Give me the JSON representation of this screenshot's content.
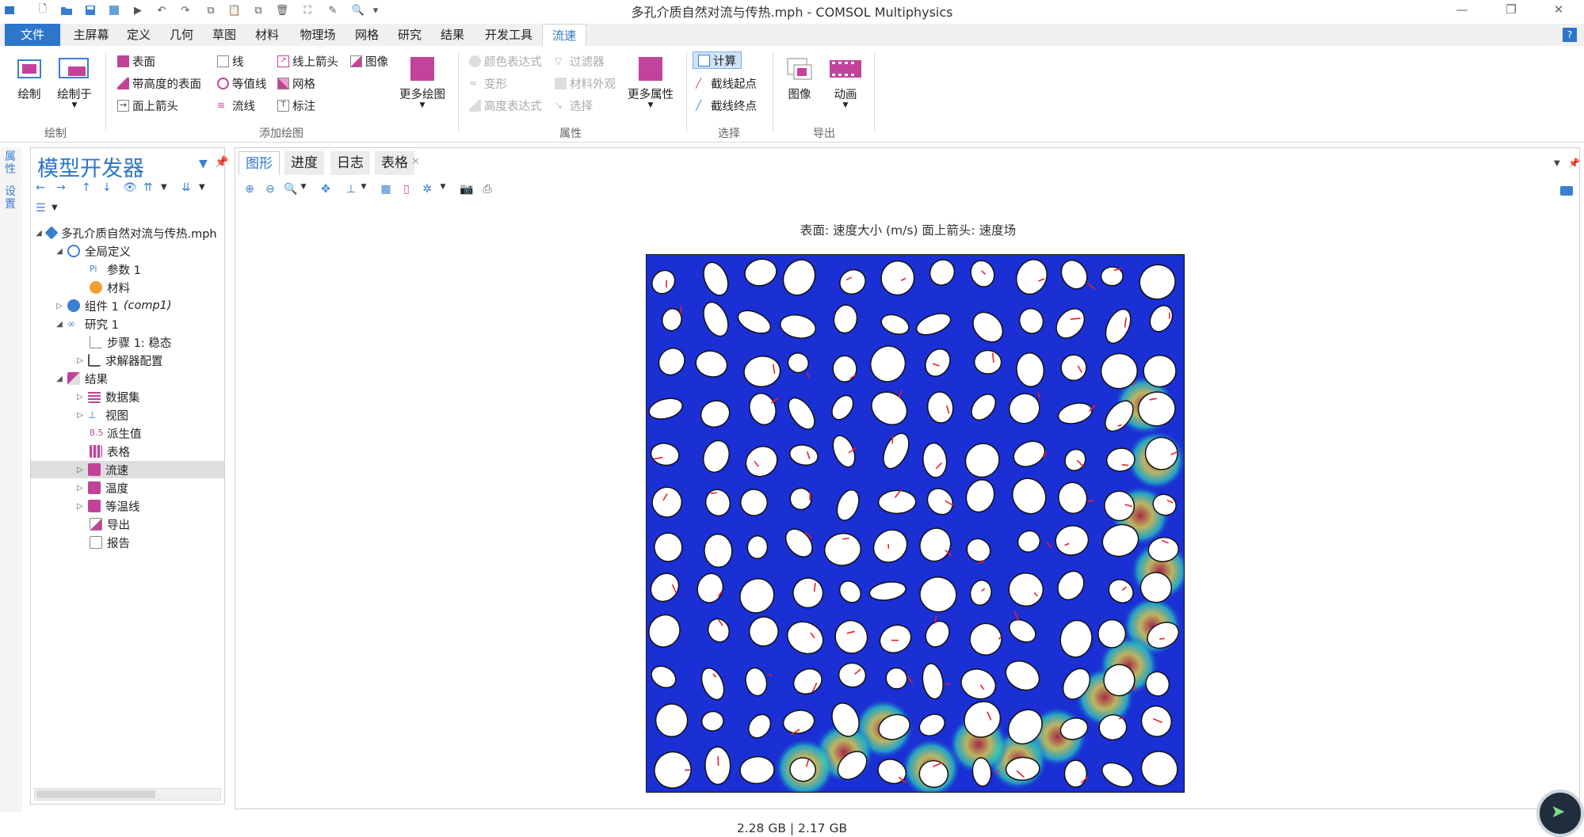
{
  "window": {
    "title": "多孔介质自然对流与传热.mph - COMSOL Multiphysics",
    "minimize": "—",
    "restore": "❐",
    "close": "✕"
  },
  "menu": {
    "file": "文件",
    "tabs": [
      "主屏幕",
      "定义",
      "几何",
      "草图",
      "材料",
      "物理场",
      "网格",
      "研究",
      "结果",
      "开发工具",
      "流速"
    ],
    "help": "?"
  },
  "ribbon": {
    "plot": {
      "draw": "绘制",
      "draw_to": "绘制于",
      "group": "绘制"
    },
    "add_plot": {
      "surface": "表面",
      "height_surface": "带高度的表面",
      "arrow_surface": "面上箭头",
      "line": "线",
      "contour": "等值线",
      "streamline": "流线",
      "arrow_line": "线上箭头",
      "mesh": "网格",
      "annotation": "标注",
      "image": "图像",
      "more_plots": "更多绘图",
      "group": "添加绘图"
    },
    "attributes": {
      "color_expr": "颜色表达式",
      "deformation": "变形",
      "height_expr": "高度表达式",
      "filter": "过滤器",
      "material_appearance": "材料外观",
      "selection": "选择",
      "more_attrs": "更多属性",
      "group": "属性"
    },
    "select": {
      "compute": "计算",
      "cut_start": "截线起点",
      "cut_end": "截线终点",
      "group": "选择"
    },
    "export": {
      "image": "图像",
      "animation": "动画",
      "group": "导出"
    }
  },
  "left_strip": {
    "prop": "属性",
    "settings": "设置"
  },
  "model_builder": {
    "title": "模型开发器",
    "tree": [
      {
        "label": "多孔介质自然对流与传热.mph",
        "level": 0
      },
      {
        "label": "全局定义",
        "level": 1
      },
      {
        "label": "参数 1",
        "level": 2
      },
      {
        "label": "材料",
        "level": 2
      },
      {
        "label": "组件 1",
        "sub": "(comp1)",
        "level": 1
      },
      {
        "label": "研究 1",
        "level": 1
      },
      {
        "label": "步骤 1: 稳态",
        "level": 2
      },
      {
        "label": "求解器配置",
        "level": 2
      },
      {
        "label": "结果",
        "level": 1
      },
      {
        "label": "数据集",
        "level": 2
      },
      {
        "label": "视图",
        "level": 2
      },
      {
        "label": "派生值",
        "level": 2
      },
      {
        "label": "表格",
        "level": 2
      },
      {
        "label": "流速",
        "level": 2
      },
      {
        "label": "温度",
        "level": 2
      },
      {
        "label": "等温线",
        "level": 2
      },
      {
        "label": "导出",
        "level": 2
      },
      {
        "label": "报告",
        "level": 2
      }
    ]
  },
  "main": {
    "tabs": [
      "图形",
      "进度",
      "日志",
      "表格"
    ],
    "plot_title": "表面: 速度大小 (m/s)  面上箭头: 速度场",
    "colors": {
      "fluid": "#1a2fd4",
      "fast": "#f2e23a",
      "peak": "#d42a18"
    }
  },
  "status": {
    "memory": "2.28 GB | 2.17 GB"
  }
}
